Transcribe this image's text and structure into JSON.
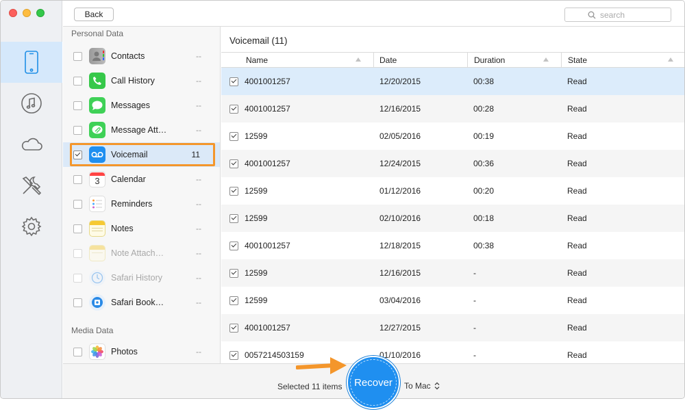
{
  "toolbar": {
    "back_label": "Back",
    "search_placeholder": "search"
  },
  "sidebar": {
    "items": [
      {
        "icon": "iphone-icon",
        "active": true
      },
      {
        "icon": "music-note-icon",
        "active": false
      },
      {
        "icon": "cloud-icon",
        "active": false
      },
      {
        "icon": "tools-icon",
        "active": false
      },
      {
        "icon": "gear-icon",
        "active": false
      }
    ]
  },
  "categories": {
    "personal_heading": "Personal Data",
    "media_heading": "Media Data",
    "items": [
      {
        "label": "Contacts",
        "count": "--",
        "icon": "contacts-icon"
      },
      {
        "label": "Call History",
        "count": "--",
        "icon": "phone-icon"
      },
      {
        "label": "Messages",
        "count": "--",
        "icon": "messages-icon"
      },
      {
        "label": "Message Att…",
        "count": "--",
        "icon": "message-attachment-icon"
      },
      {
        "label": "Voicemail",
        "count": "11",
        "icon": "voicemail-icon"
      },
      {
        "label": "Calendar",
        "count": "--",
        "icon": "calendar-icon",
        "day": "3"
      },
      {
        "label": "Reminders",
        "count": "--",
        "icon": "reminders-icon"
      },
      {
        "label": "Notes",
        "count": "--",
        "icon": "notes-icon"
      },
      {
        "label": "Note Attach…",
        "count": "--",
        "icon": "note-attachment-icon"
      },
      {
        "label": "Safari History",
        "count": "--",
        "icon": "safari-icon"
      },
      {
        "label": "Safari Book…",
        "count": "--",
        "icon": "safari-bookmark-icon"
      }
    ],
    "media_items": [
      {
        "label": "Photos",
        "count": "--",
        "icon": "photos-icon"
      }
    ]
  },
  "main": {
    "title": "Voicemail (11)",
    "columns": [
      "Name",
      "Date",
      "Duration",
      "State"
    ],
    "rows": [
      {
        "name": "4001001257",
        "date": "12/20/2015",
        "duration": "00:38",
        "state": "Read"
      },
      {
        "name": "4001001257",
        "date": "12/16/2015",
        "duration": "00:28",
        "state": "Read"
      },
      {
        "name": "12599",
        "date": "02/05/2016",
        "duration": "00:19",
        "state": "Read"
      },
      {
        "name": "4001001257",
        "date": "12/24/2015",
        "duration": "00:36",
        "state": "Read"
      },
      {
        "name": "12599",
        "date": "01/12/2016",
        "duration": "00:20",
        "state": "Read"
      },
      {
        "name": "12599",
        "date": "02/10/2016",
        "duration": "00:18",
        "state": "Read"
      },
      {
        "name": "4001001257",
        "date": "12/18/2015",
        "duration": "00:38",
        "state": "Read"
      },
      {
        "name": "12599",
        "date": "12/16/2015",
        "duration": "-",
        "state": "Read"
      },
      {
        "name": "12599",
        "date": "03/04/2016",
        "duration": "-",
        "state": "Read"
      },
      {
        "name": "4001001257",
        "date": "12/27/2015",
        "duration": "-",
        "state": "Read"
      },
      {
        "name": "0057214503159",
        "date": "01/10/2016",
        "duration": "-",
        "state": "Read"
      }
    ]
  },
  "footer": {
    "selected_text": "Selected 11 items",
    "recover_label": "Recover",
    "destination": "To Mac"
  },
  "colors": {
    "accent": "#1f8ff0",
    "highlight_outline": "#f4962b",
    "selected_row": "#dcecfb"
  }
}
